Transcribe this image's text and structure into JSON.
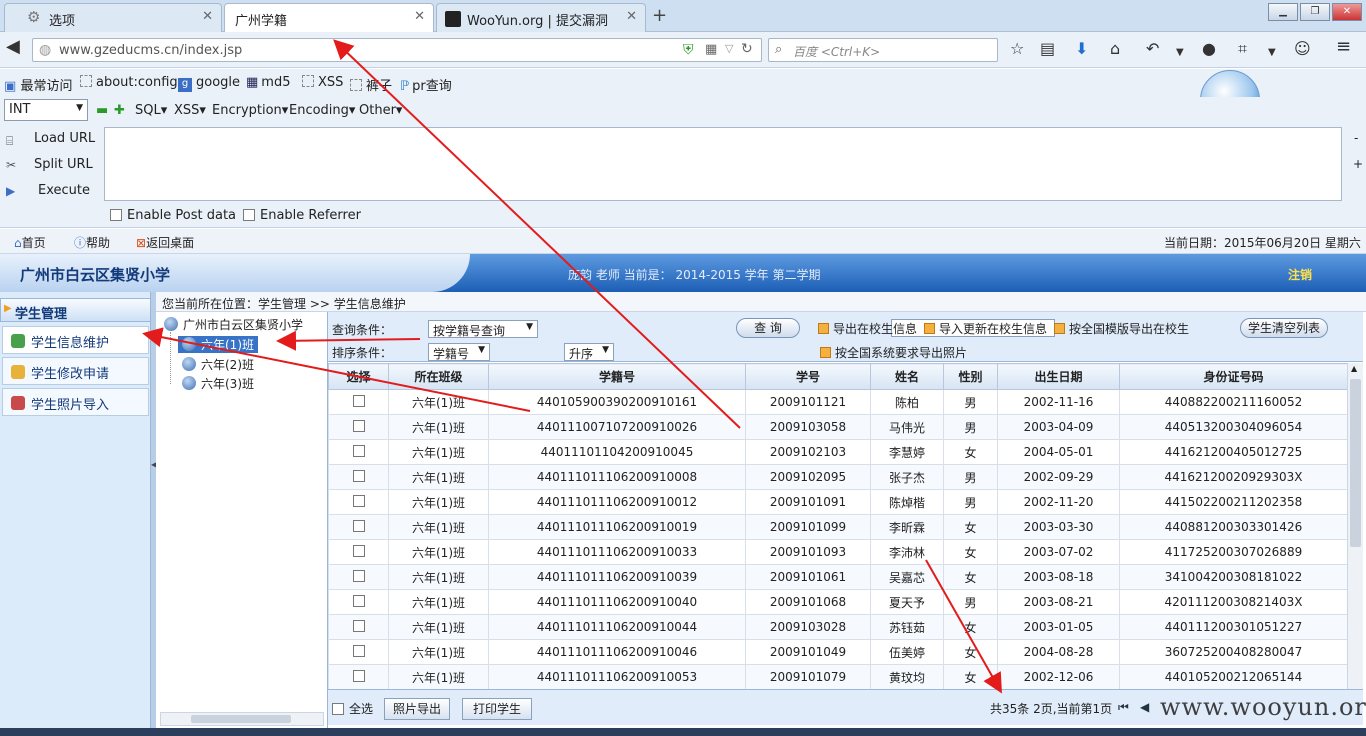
{
  "browser": {
    "tabs": [
      {
        "label": "选项",
        "active": false
      },
      {
        "label": "广州学籍",
        "active": true
      },
      {
        "label": "WooYun.org | 提交漏洞",
        "active": false
      }
    ],
    "url": "www.gzeducms.cn/index.jsp",
    "search_placeholder": "百度 <Ctrl+K>",
    "bookmarks": [
      "最常访问",
      "about:config",
      "google",
      "md5",
      "XSS",
      "裤子",
      "pr查询"
    ]
  },
  "hackbar": {
    "type_select": "INT",
    "menus": [
      "SQL▾",
      "XSS▾",
      "Encryption▾",
      "Encoding▾",
      "Other▾"
    ],
    "actions": [
      "Load URL",
      "Split URL",
      "Execute"
    ],
    "options": [
      "Enable Post data",
      "Enable Referrer"
    ]
  },
  "app": {
    "toplinks": [
      "首页",
      "帮助",
      "返回桌面"
    ],
    "current_date": "当前日期：2015年06月20日 星期六",
    "school_name": "广州市白云区集贤小学",
    "teacher_info": "庞韵 老师   当前是： 2014-2015 学年   第二学期",
    "logout": "注销",
    "breadcrumb": "您当前所在位置：学生管理 >> 学生信息维护"
  },
  "leftmenu": {
    "header": "学生管理",
    "items": [
      "学生信息维护",
      "学生修改申请",
      "学生照片导入"
    ]
  },
  "tree": {
    "root": "广州市白云区集贤小学",
    "classes": [
      "六年(1)班",
      "六年(2)班",
      "六年(3)班"
    ]
  },
  "query": {
    "condition_label": "查询条件：",
    "condition_value": "按学籍号查询",
    "sort_label": "排序条件：",
    "sort_field": "学籍号",
    "sort_order": "升序",
    "search_button": "查 询",
    "links": [
      "导出在校生信息",
      "导入更新在校生信息",
      "按全国模版导出在校生",
      "按全国系统要求导出照片"
    ],
    "clear_button": "学生清空列表"
  },
  "table": {
    "headers": [
      "选择",
      "所在班级",
      "学籍号",
      "学号",
      "姓名",
      "性别",
      "出生日期",
      "身份证号码"
    ],
    "rows": [
      [
        "六年(1)班",
        "44010590039020091016​1",
        "2009101121",
        "陈柏",
        "男",
        "2002-11-16",
        "440882200211160052"
      ],
      [
        "六年(1)班",
        "440111007107200910026",
        "2009103058",
        "马伟光",
        "男",
        "2003-04-09",
        "440513200304096054"
      ],
      [
        "六年(1)班",
        "440111011042009100​45",
        "2009102103",
        "李慧婷",
        "女",
        "2004-05-01",
        "441621200405012725"
      ],
      [
        "六年(1)班",
        "440111011106200910008",
        "2009102095",
        "张子杰",
        "男",
        "2002-09-29",
        "44162120020929303X"
      ],
      [
        "六年(1)班",
        "440111011106200910012",
        "2009101091",
        "陈焯楷",
        "男",
        "2002-11-20",
        "441502200211202358"
      ],
      [
        "六年(1)班",
        "440111011106200910019",
        "2009101099",
        "李昕霖",
        "女",
        "2003-03-30",
        "440881200303301426"
      ],
      [
        "六年(1)班",
        "440111011106200910033",
        "2009101093",
        "李沛林",
        "女",
        "2003-07-02",
        "411725200307026889"
      ],
      [
        "六年(1)班",
        "440111011106200910039",
        "2009101061",
        "吴嘉芯",
        "女",
        "2003-08-18",
        "341004200308181022"
      ],
      [
        "六年(1)班",
        "440111011106200910040",
        "2009101068",
        "夏天予",
        "男",
        "2003-08-21",
        "42011120030821403X"
      ],
      [
        "六年(1)班",
        "440111011106200910044",
        "2009103028",
        "苏钰茹",
        "女",
        "2003-01-05",
        "440111200301051227"
      ],
      [
        "六年(1)班",
        "440111011106200910046",
        "2009101049",
        "伍美婷",
        "女",
        "2004-08-28",
        "360725200408280047"
      ],
      [
        "六年(1)班",
        "440111011106200910053",
        "2009101079",
        "黄玟均",
        "女",
        "2002-12-06",
        "440105200212065144"
      ]
    ]
  },
  "footer": {
    "select_all": "全选",
    "buttons": [
      "照片导出",
      "打印学生"
    ],
    "page_info": "共35条 2页,当前第1页",
    "watermark": "www.wooyun.org"
  }
}
